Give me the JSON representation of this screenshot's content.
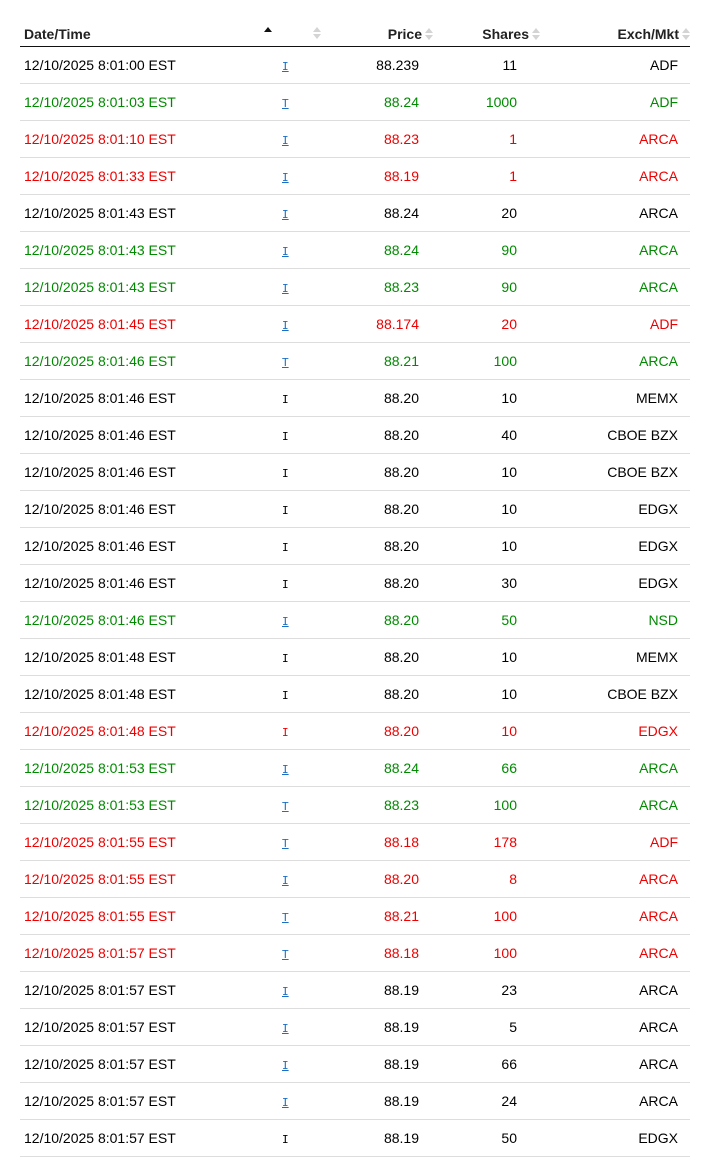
{
  "headers": {
    "datetime": "Date/Time",
    "type": "",
    "price": "Price",
    "shares": "Shares",
    "exch": "Exch/Mkt"
  },
  "sort": {
    "column": "datetime",
    "direction": "asc"
  },
  "colors": {
    "black": "#000000",
    "green": "#008a00",
    "red": "#ee0000",
    "link": "#1a6fc4"
  },
  "rows": [
    {
      "datetime": "12/10/2025 8:01:00 EST",
      "type": "I",
      "linked": true,
      "price": "88.239",
      "shares": "11",
      "exch": "ADF",
      "color": "black"
    },
    {
      "datetime": "12/10/2025 8:01:03 EST",
      "type": "T",
      "linked": true,
      "price": "88.24",
      "shares": "1000",
      "exch": "ADF",
      "color": "green"
    },
    {
      "datetime": "12/10/2025 8:01:10 EST",
      "type": "I",
      "linked": true,
      "price": "88.23",
      "shares": "1",
      "exch": "ARCA",
      "color": "red"
    },
    {
      "datetime": "12/10/2025 8:01:33 EST",
      "type": "I",
      "linked": true,
      "price": "88.19",
      "shares": "1",
      "exch": "ARCA",
      "color": "red"
    },
    {
      "datetime": "12/10/2025 8:01:43 EST",
      "type": "I",
      "linked": true,
      "price": "88.24",
      "shares": "20",
      "exch": "ARCA",
      "color": "black"
    },
    {
      "datetime": "12/10/2025 8:01:43 EST",
      "type": "I",
      "linked": true,
      "price": "88.24",
      "shares": "90",
      "exch": "ARCA",
      "color": "green"
    },
    {
      "datetime": "12/10/2025 8:01:43 EST",
      "type": "I",
      "linked": true,
      "price": "88.23",
      "shares": "90",
      "exch": "ARCA",
      "color": "green"
    },
    {
      "datetime": "12/10/2025 8:01:45 EST",
      "type": "I",
      "linked": true,
      "price": "88.174",
      "shares": "20",
      "exch": "ADF",
      "color": "red"
    },
    {
      "datetime": "12/10/2025 8:01:46 EST",
      "type": "T",
      "linked": true,
      "price": "88.21",
      "shares": "100",
      "exch": "ARCA",
      "color": "green"
    },
    {
      "datetime": "12/10/2025 8:01:46 EST",
      "type": "I",
      "linked": false,
      "price": "88.20",
      "shares": "10",
      "exch": "MEMX",
      "color": "black"
    },
    {
      "datetime": "12/10/2025 8:01:46 EST",
      "type": "I",
      "linked": false,
      "price": "88.20",
      "shares": "40",
      "exch": "CBOE BZX",
      "color": "black"
    },
    {
      "datetime": "12/10/2025 8:01:46 EST",
      "type": "I",
      "linked": false,
      "price": "88.20",
      "shares": "10",
      "exch": "CBOE BZX",
      "color": "black"
    },
    {
      "datetime": "12/10/2025 8:01:46 EST",
      "type": "I",
      "linked": false,
      "price": "88.20",
      "shares": "10",
      "exch": "EDGX",
      "color": "black"
    },
    {
      "datetime": "12/10/2025 8:01:46 EST",
      "type": "I",
      "linked": false,
      "price": "88.20",
      "shares": "10",
      "exch": "EDGX",
      "color": "black"
    },
    {
      "datetime": "12/10/2025 8:01:46 EST",
      "type": "I",
      "linked": false,
      "price": "88.20",
      "shares": "30",
      "exch": "EDGX",
      "color": "black"
    },
    {
      "datetime": "12/10/2025 8:01:46 EST",
      "type": "I",
      "linked": true,
      "price": "88.20",
      "shares": "50",
      "exch": "NSD",
      "color": "green"
    },
    {
      "datetime": "12/10/2025 8:01:48 EST",
      "type": "I",
      "linked": false,
      "price": "88.20",
      "shares": "10",
      "exch": "MEMX",
      "color": "black"
    },
    {
      "datetime": "12/10/2025 8:01:48 EST",
      "type": "I",
      "linked": false,
      "price": "88.20",
      "shares": "10",
      "exch": "CBOE BZX",
      "color": "black"
    },
    {
      "datetime": "12/10/2025 8:01:48 EST",
      "type": "I",
      "linked": false,
      "price": "88.20",
      "shares": "10",
      "exch": "EDGX",
      "color": "red"
    },
    {
      "datetime": "12/10/2025 8:01:53 EST",
      "type": "I",
      "linked": true,
      "price": "88.24",
      "shares": "66",
      "exch": "ARCA",
      "color": "green"
    },
    {
      "datetime": "12/10/2025 8:01:53 EST",
      "type": "T",
      "linked": true,
      "price": "88.23",
      "shares": "100",
      "exch": "ARCA",
      "color": "green"
    },
    {
      "datetime": "12/10/2025 8:01:55 EST",
      "type": "T",
      "linked": true,
      "price": "88.18",
      "shares": "178",
      "exch": "ADF",
      "color": "red"
    },
    {
      "datetime": "12/10/2025 8:01:55 EST",
      "type": "I",
      "linked": true,
      "price": "88.20",
      "shares": "8",
      "exch": "ARCA",
      "color": "red"
    },
    {
      "datetime": "12/10/2025 8:01:55 EST",
      "type": "T",
      "linked": true,
      "price": "88.21",
      "shares": "100",
      "exch": "ARCA",
      "color": "red"
    },
    {
      "datetime": "12/10/2025 8:01:57 EST",
      "type": "T",
      "linked": true,
      "price": "88.18",
      "shares": "100",
      "exch": "ARCA",
      "color": "red"
    },
    {
      "datetime": "12/10/2025 8:01:57 EST",
      "type": "I",
      "linked": true,
      "price": "88.19",
      "shares": "23",
      "exch": "ARCA",
      "color": "black"
    },
    {
      "datetime": "12/10/2025 8:01:57 EST",
      "type": "I",
      "linked": true,
      "price": "88.19",
      "shares": "5",
      "exch": "ARCA",
      "color": "black"
    },
    {
      "datetime": "12/10/2025 8:01:57 EST",
      "type": "I",
      "linked": true,
      "price": "88.19",
      "shares": "66",
      "exch": "ARCA",
      "color": "black"
    },
    {
      "datetime": "12/10/2025 8:01:57 EST",
      "type": "I",
      "linked": true,
      "price": "88.19",
      "shares": "24",
      "exch": "ARCA",
      "color": "black"
    },
    {
      "datetime": "12/10/2025 8:01:57 EST",
      "type": "I",
      "linked": false,
      "price": "88.19",
      "shares": "50",
      "exch": "EDGX",
      "color": "black"
    }
  ]
}
